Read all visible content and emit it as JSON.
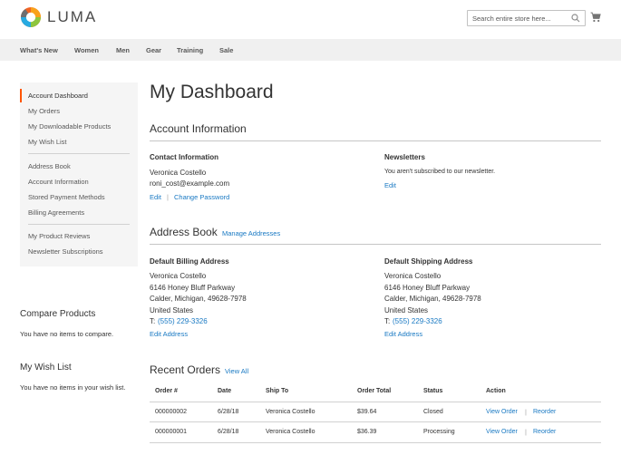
{
  "brand": {
    "name": "LUMA"
  },
  "search": {
    "placeholder": "Search entire store here..."
  },
  "nav": {
    "items": [
      "What's New",
      "Women",
      "Men",
      "Gear",
      "Training",
      "Sale"
    ]
  },
  "sidebar": {
    "group1": [
      "Account Dashboard",
      "My Orders",
      "My Downloadable Products",
      "My Wish List"
    ],
    "group2": [
      "Address Book",
      "Account Information",
      "Stored Payment Methods",
      "Billing Agreements"
    ],
    "group3": [
      "My Product Reviews",
      "Newsletter Subscriptions"
    ]
  },
  "compare": {
    "title": "Compare Products",
    "empty": "You have no items to compare."
  },
  "wishlist": {
    "title": "My Wish List",
    "empty": "You have no items in your wish list."
  },
  "page": {
    "title": "My Dashboard"
  },
  "account_info": {
    "title": "Account Information",
    "contact": {
      "title": "Contact Information",
      "name": "Veronica Costello",
      "email": "roni_cost@example.com",
      "edit": "Edit",
      "separator": "|",
      "change_password": "Change Password"
    },
    "newsletters": {
      "title": "Newsletters",
      "text": "You aren't subscribed to our newsletter.",
      "edit": "Edit"
    }
  },
  "address_book": {
    "title": "Address Book",
    "manage": "Manage Addresses",
    "billing": {
      "title": "Default Billing Address",
      "name": "Veronica Costello",
      "street": "6146 Honey Bluff Parkway",
      "city": "Calder, Michigan, 49628-7978",
      "country": "United States",
      "phone_prefix": "T:",
      "phone": "(555) 229-3326",
      "edit": "Edit Address"
    },
    "shipping": {
      "title": "Default Shipping Address",
      "name": "Veronica Costello",
      "street": "6146 Honey Bluff Parkway",
      "city": "Calder, Michigan, 49628-7978",
      "country": "United States",
      "phone_prefix": "T:",
      "phone": "(555) 229-3326",
      "edit": "Edit Address"
    }
  },
  "recent_orders": {
    "title": "Recent Orders",
    "view_all": "View All",
    "columns": [
      "Order #",
      "Date",
      "Ship To",
      "Order Total",
      "Status",
      "Action"
    ],
    "rows": [
      {
        "order": "000000002",
        "date": "6/28/18",
        "ship_to": "Veronica Costello",
        "total": "$39.64",
        "status": "Closed",
        "view": "View Order",
        "sep": "|",
        "reorder": "Reorder"
      },
      {
        "order": "000000001",
        "date": "6/28/18",
        "ship_to": "Veronica Costello",
        "total": "$36.39",
        "status": "Processing",
        "view": "View Order",
        "sep": "|",
        "reorder": "Reorder"
      }
    ]
  },
  "colors": {
    "link": "#1979c3",
    "active_marker": "#ff5501",
    "nav_bg": "#f0f0f0",
    "sidebar_bg": "#f5f5f5"
  }
}
